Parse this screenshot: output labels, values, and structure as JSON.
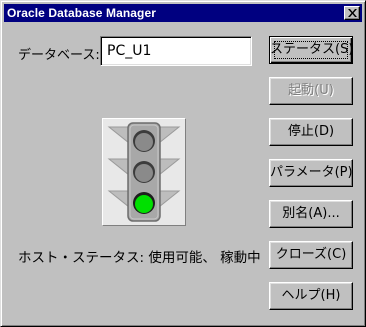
{
  "window": {
    "title": "Oracle Database Manager"
  },
  "database": {
    "label": "データベース:",
    "value": "PC_U1"
  },
  "buttons": {
    "status": "ステータス(S)",
    "startup": "起動(U)",
    "stop": "停止(D)",
    "parameters": "パラメータ(P)",
    "alias": "別名(A)...",
    "close": "クローズ(C)",
    "help": "ヘルプ(H)"
  },
  "host_status": {
    "text": "ホスト・ステータス: 使用可能、 稼動中"
  },
  "traffic_light": {
    "active": "green"
  }
}
